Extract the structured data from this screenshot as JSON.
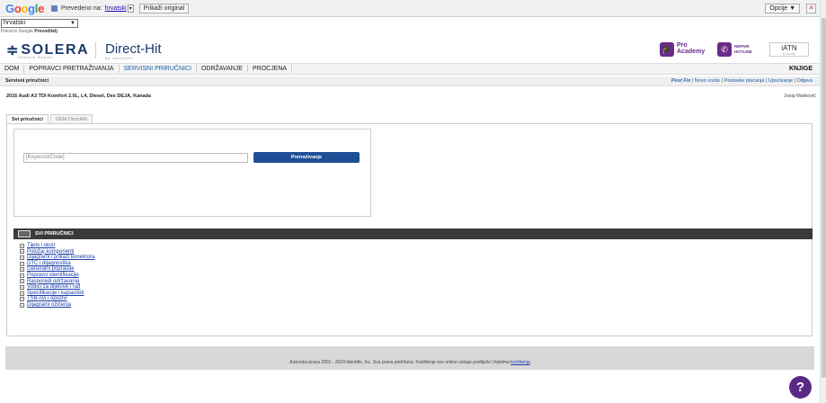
{
  "google_bar": {
    "logo": "Google",
    "translated_to_label": "Prevedeno na:",
    "language": "hrvatski",
    "show_original": "Prikaži original",
    "options": "Opcije ▼",
    "close": "✕"
  },
  "language_select": {
    "value": "hrvatski",
    "powered_prefix": "Pokreće",
    "powered_logo": "Google",
    "powered_product": "Prevoditelj"
  },
  "header": {
    "brand": "SOLERA",
    "brand_sub": "Vehicle Repair",
    "product": "Direct-Hit",
    "product_sub": "by Identifix",
    "pro_academy": [
      "Pro",
      "Academy"
    ],
    "repair_hotline": [
      "REPAIR",
      "HOTLINE"
    ],
    "iatn": "iATN",
    "iatn_sub": "by Identifix"
  },
  "nav": {
    "items": [
      "DOM",
      "POPRAVCI PRETRAŽIVANJA",
      "SERVISNI PRIRUČNICI",
      "ODRŽAVANJE",
      "PROCJENA"
    ],
    "active_index": 2,
    "books": "KNJIGE"
  },
  "subheader": {
    "section": "Servisni priručnici",
    "links": [
      "Post Fix",
      "Novo vozilo",
      "Postavke plaćanja",
      "Upućivanje",
      "Odjava"
    ]
  },
  "vehicle": "2016 Audi A3 TDI Komfort 2.0L, L4, Diesel, Dex DEJA, Kanada",
  "user": "Josip Matković",
  "tabs": [
    "Svi priručnici",
    "OEM DirectHit"
  ],
  "search": {
    "placeholder": "[Keyword/Code]",
    "button": "Pretraživanje"
  },
  "manuals": {
    "title": "SVI PRIRUČNICI",
    "items": [
      "Tijelo i okvir",
      "Položaj komponenti",
      "Dijagrami i prikazi konektora",
      "DTC i dijagnostika",
      "Generalni popravak",
      "Popravci identifikacije",
      "Rasporedi održavanja",
      "Vodiči za dijelove i rad",
      "Specifikacije i kapaciteti",
      "TSB-ovi i opozivi",
      "Dijagrami ožičenja"
    ]
  },
  "footer": {
    "text": "Autorska prava 2001 - 2024 Identifix, Inc. Sva prava pridržana. Korištenje ove online usluge podliježe Uvjetima",
    "link": "korištenja"
  },
  "help": "?"
}
